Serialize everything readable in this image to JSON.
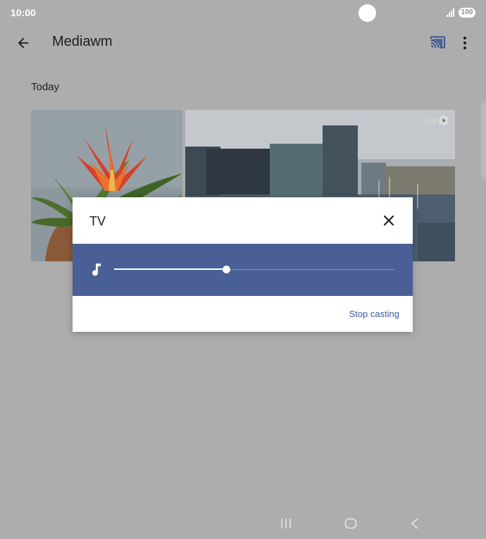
{
  "status_bar": {
    "time": "10:00",
    "battery": "100"
  },
  "app_bar": {
    "title": "Mediawm",
    "icons": [
      "back-arrow-icon",
      "cast-connected-icon",
      "more-vert-icon"
    ]
  },
  "section": {
    "label": "Today"
  },
  "video": {
    "duration": "0:05"
  },
  "cast_dialog": {
    "title": "TV",
    "volume_level": 0.4,
    "stop_label": "Stop casting",
    "accent_color": "#4a5f96"
  },
  "nav_bar": {
    "icons": [
      "recent-apps-icon",
      "home-icon",
      "back-icon"
    ]
  }
}
